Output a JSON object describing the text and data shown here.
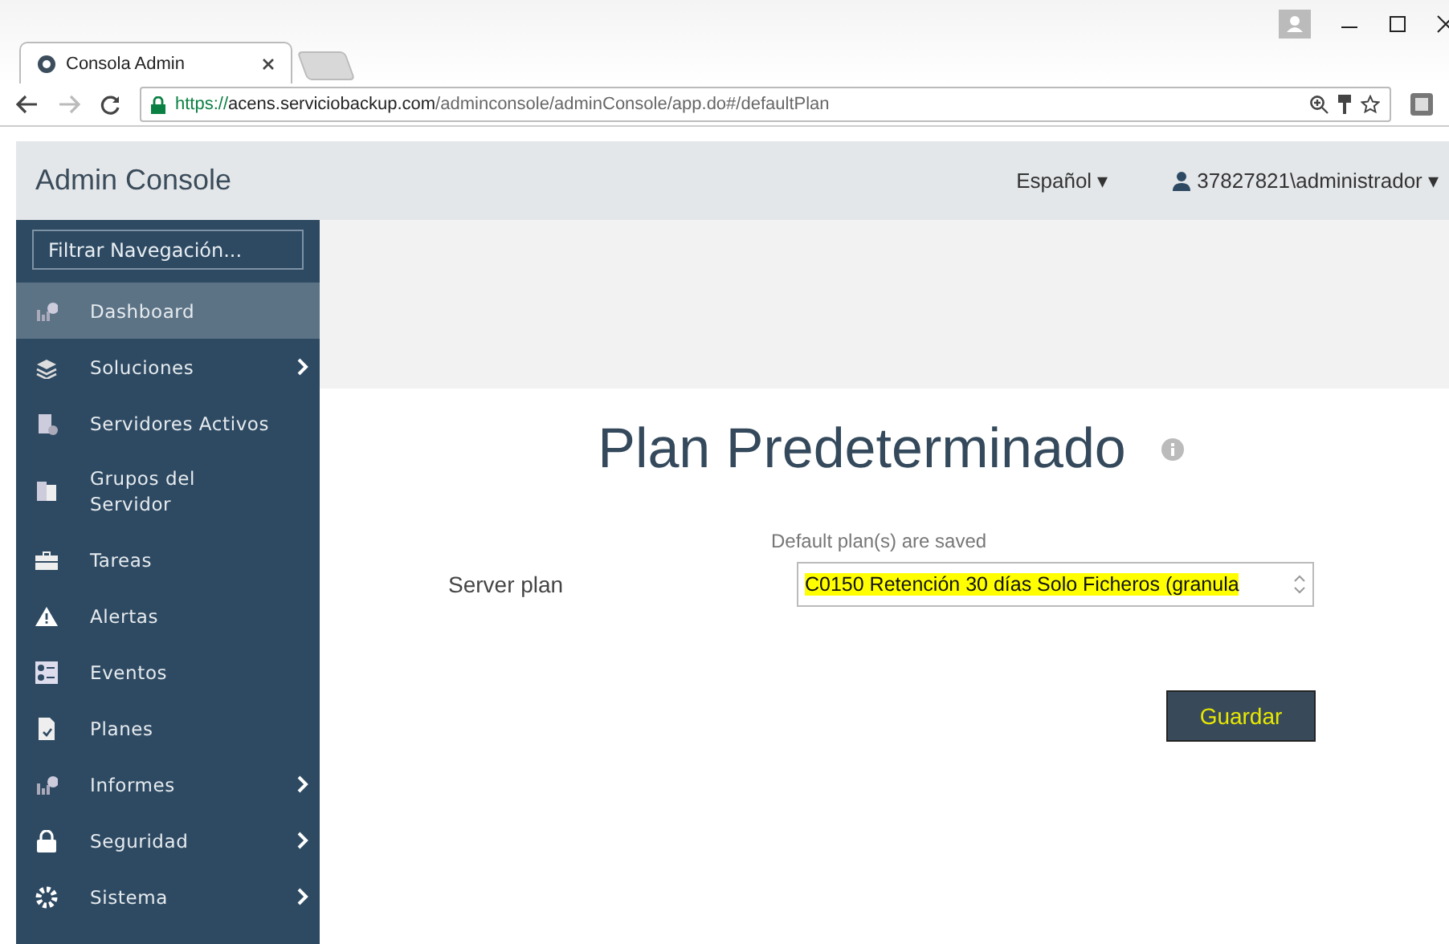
{
  "browser": {
    "tab": {
      "title": "Consola Admin",
      "selected": true
    },
    "url": {
      "scheme": "https://",
      "host": "acens.serviciobackup.com",
      "path": "/adminconsole/adminConsole/app.do#/defaultPlan"
    }
  },
  "header": {
    "title": "Admin Console",
    "language": "Español ▾",
    "user": "37827821\\administrador ▾"
  },
  "sidebar": {
    "filter": {
      "placeholder": "Filtrar Navegación..."
    },
    "items": [
      {
        "label": "Dashboard",
        "selected": true,
        "submenu": false
      },
      {
        "label": "Soluciones",
        "selected": false,
        "submenu": true
      },
      {
        "label": "Servidores Activos",
        "selected": false,
        "submenu": false
      },
      {
        "label": "Grupos del\nServidor",
        "selected": false,
        "submenu": false
      },
      {
        "label": "Tareas",
        "selected": false,
        "submenu": false
      },
      {
        "label": "Alertas",
        "selected": false,
        "submenu": false
      },
      {
        "label": "Eventos",
        "selected": false,
        "submenu": false
      },
      {
        "label": "Planes",
        "selected": false,
        "submenu": false
      },
      {
        "label": "Informes",
        "selected": false,
        "submenu": true
      },
      {
        "label": "Seguridad",
        "selected": false,
        "submenu": true
      },
      {
        "label": "Sistema",
        "selected": false,
        "submenu": true
      }
    ]
  },
  "page": {
    "title": "Plan Predeterminado",
    "message": "Default plan(s) are saved",
    "field_label": "Server plan",
    "plan_select": {
      "value": "C0150 Retención 30 días Solo Ficheros (granula",
      "highlighted": true
    },
    "save_button": {
      "label": "Guardar",
      "highlighted": true
    }
  }
}
